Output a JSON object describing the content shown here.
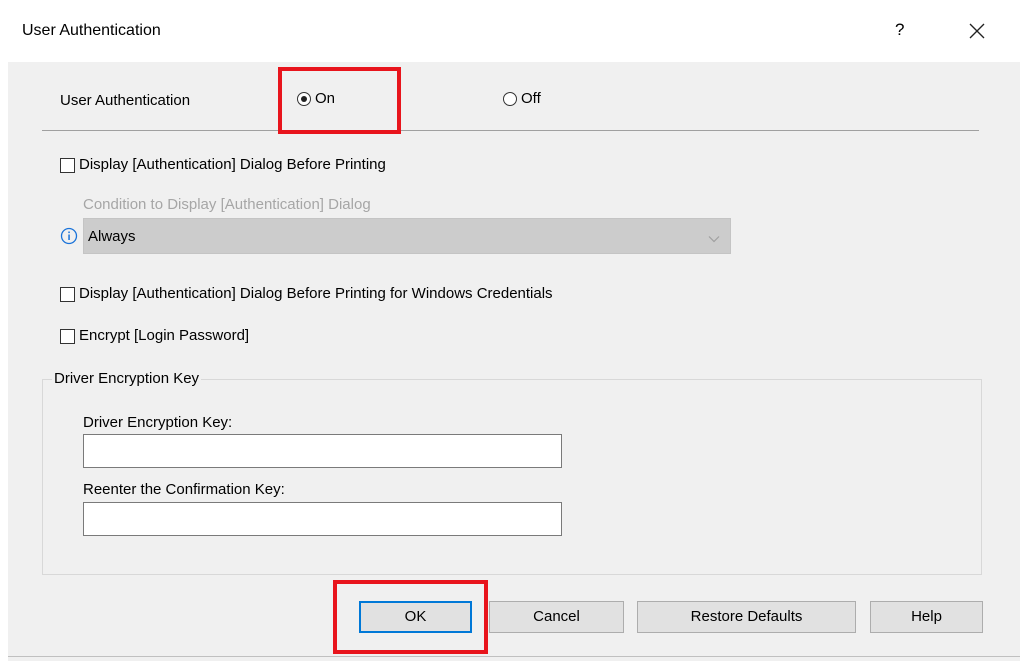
{
  "window": {
    "title": "User Authentication",
    "help_glyph": "?",
    "close_glyph": "×"
  },
  "user_auth": {
    "label": "User Authentication",
    "options": [
      {
        "label": "On",
        "selected": true
      },
      {
        "label": "Off",
        "selected": false
      }
    ]
  },
  "checkboxes": {
    "display_before_printing": {
      "label": "Display [Authentication] Dialog Before Printing",
      "checked": false
    },
    "display_windows_credentials": {
      "label": "Display [Authentication] Dialog Before Printing for Windows Credentials",
      "checked": false
    },
    "encrypt_login_password": {
      "label": "Encrypt [Login Password]",
      "checked": false
    }
  },
  "condition": {
    "label": "Condition to Display [Authentication] Dialog",
    "value": "Always",
    "enabled": false
  },
  "encryption": {
    "group_title": "Driver Encryption Key",
    "key_label": "Driver Encryption Key:",
    "key_value": "",
    "confirm_label": "Reenter the Confirmation Key:",
    "confirm_value": ""
  },
  "buttons": {
    "ok": "OK",
    "cancel": "Cancel",
    "restore_defaults": "Restore Defaults",
    "help": "Help"
  },
  "colors": {
    "highlight": "#e8141c",
    "default_button_border": "#0078d7",
    "info_icon": "#1a73d9"
  }
}
